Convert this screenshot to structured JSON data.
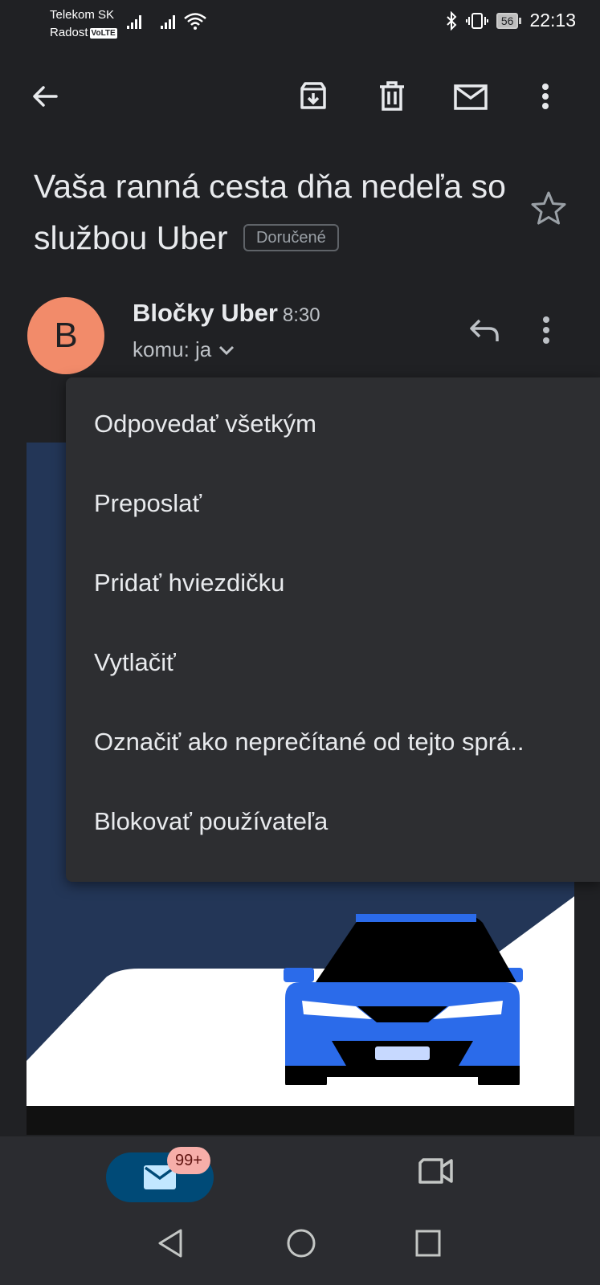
{
  "status_bar": {
    "carrier_1": "Telekom SK",
    "carrier_2": "Radost",
    "volte": "VoLTE",
    "battery": "56",
    "time": "22:13"
  },
  "app_bar": {
    "icons": [
      "back-arrow-icon",
      "archive-icon",
      "delete-icon",
      "mark-unread-icon",
      "more-vert-icon"
    ]
  },
  "email": {
    "subject": "Vaša ranná cesta dňa nedeľa so službou Uber",
    "label": "Doručené",
    "sender_initial": "B",
    "sender": "Bločky Uber",
    "time": "8:30",
    "recipient": "komu: ja"
  },
  "menu": {
    "items": [
      "Odpovedať všetkým",
      "Preposlať",
      "Pridať hviezdičku",
      "Vytlačiť",
      "Označiť ako neprečítané od tejto sprá..",
      "Blokovať používateľa"
    ]
  },
  "bottom_nav": {
    "mail_badge": "99+"
  },
  "colors": {
    "background": "#202124",
    "avatar": "#f28b6a",
    "menu": "#2d2e31",
    "mail_pill": "#004a77",
    "badge": "#f6aea9",
    "car_blue": "#2b6bea",
    "hero_navy": "#233657"
  }
}
